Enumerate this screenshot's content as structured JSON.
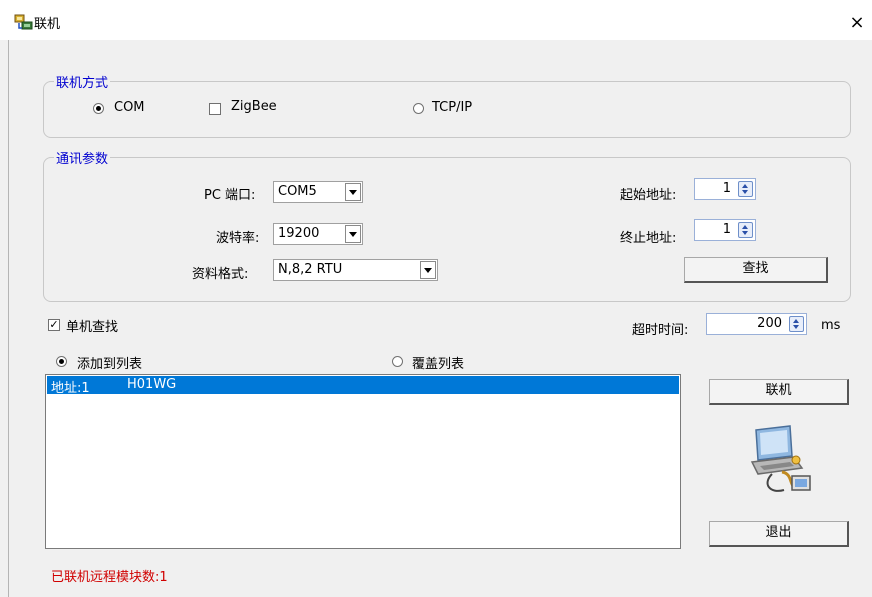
{
  "window": {
    "title": "联机",
    "close_symbol": "×"
  },
  "connection_mode": {
    "legend": "联机方式",
    "options": [
      {
        "label": "COM",
        "type": "radio",
        "selected": true
      },
      {
        "label": "ZigBee",
        "type": "checkbox",
        "checked": false
      },
      {
        "label": "TCP/IP",
        "type": "radio",
        "selected": false
      }
    ]
  },
  "comm_params": {
    "legend": "通讯参数",
    "port_label": "PC 端口:",
    "port_value": "COM5",
    "baud_label": "波特率:",
    "baud_value": "19200",
    "format_label": "资料格式:",
    "format_value": "N,8,2 RTU",
    "start_addr_label": "起始地址:",
    "start_addr_value": "1",
    "end_addr_label": "终止地址:",
    "end_addr_value": "1",
    "search_button": "查找"
  },
  "single_search": {
    "label": "单机查找",
    "checked": true
  },
  "timeout": {
    "label": "超时时间:",
    "value": "200",
    "unit": "ms"
  },
  "list_mode": {
    "add_label": "添加到列表",
    "add_selected": true,
    "overwrite_label": "覆盖列表",
    "overwrite_selected": false
  },
  "device_list": [
    {
      "address": "地址:1",
      "name": "H01WG",
      "selected": true
    }
  ],
  "buttons": {
    "connect": "联机",
    "exit": "退出"
  },
  "icons": {
    "title": "network-computer-icon",
    "connect_illustration": "computer-cable-icon"
  },
  "status": {
    "text": "已联机远程模块数:1",
    "color": "#d00000"
  }
}
